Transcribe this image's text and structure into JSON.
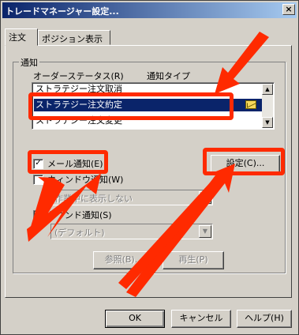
{
  "window": {
    "title": "トレードマネージャー設定...",
    "close_label": "×"
  },
  "tabs": [
    {
      "label": "注文",
      "active": true
    },
    {
      "label": "ポジション表示",
      "active": false
    }
  ],
  "notification_group": {
    "label": "通知",
    "col_order_status": "オーダーステータス(R)",
    "col_notify_type": "通知タイプ",
    "rows": [
      {
        "label": "ストラテジー注文取消",
        "selected": false
      },
      {
        "label": "ストラテジー注文約定",
        "selected": true,
        "icon": "mail-icon"
      },
      {
        "label": "ストラテジー注文変更",
        "selected": false
      }
    ],
    "email": {
      "label": "メール通知(E)",
      "checked": true
    },
    "window_notify": {
      "label": "ウィンドウ通知(W)",
      "checked": false
    },
    "combo_display": {
      "value": "作業中に表示しない"
    },
    "sound": {
      "label": "サウンド通知(S)",
      "checked": false
    },
    "combo_sound": {
      "value": "(デフォルト)"
    },
    "settings_button": "設定(C)...",
    "browse_button": "参照(B)...",
    "play_button": "再生(P)"
  },
  "footer": {
    "ok": "OK",
    "cancel": "キャンセル",
    "help": "ヘルプ(H)"
  },
  "colors": {
    "highlight": "#ff2a00",
    "selection": "#0a246a",
    "titlebar": "#0a246a"
  }
}
